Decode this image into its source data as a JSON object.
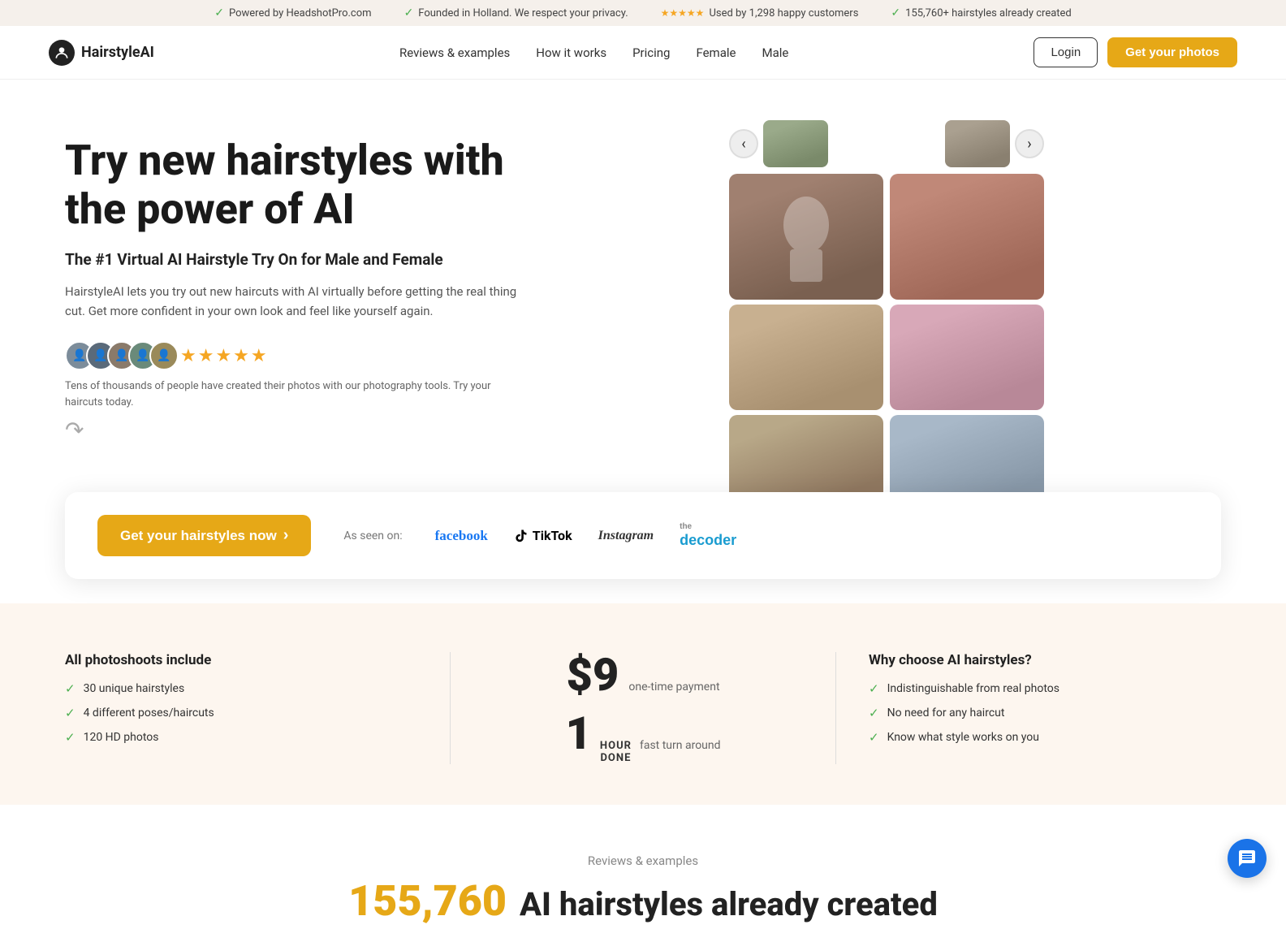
{
  "topBanner": {
    "items": [
      {
        "icon": "✓",
        "text": "Powered by HeadshotPro.com"
      },
      {
        "icon": "✓",
        "text": "Founded in Holland. We respect your privacy."
      },
      {
        "stars": "★★★★★",
        "text": "Used by 1,298 happy customers"
      },
      {
        "icon": "✓",
        "text": "155,760+ hairstyles already created"
      }
    ]
  },
  "navbar": {
    "logo": "HairstyleAI",
    "links": [
      {
        "label": "Reviews & examples",
        "href": "#"
      },
      {
        "label": "How it works",
        "href": "#"
      },
      {
        "label": "Pricing",
        "href": "#"
      },
      {
        "label": "Female",
        "href": "#"
      },
      {
        "label": "Male",
        "href": "#"
      }
    ],
    "loginLabel": "Login",
    "ctaLabel": "Get your photos"
  },
  "hero": {
    "title": "Try new hairstyles with the power of AI",
    "subtitle": "The #1 Virtual AI Hairstyle Try On for Male and Female",
    "description": "HairstyleAI lets you try out new haircuts with AI virtually before getting the real thing cut. Get more confident in your own look and feel like yourself again.",
    "stars": "★★★★★",
    "socialProof": "Tens of thousands of people have created their photos with our photography tools. Try your haircuts today."
  },
  "ctaStrip": {
    "buttonLabel": "Get your hairstyles now",
    "buttonArrow": "›",
    "asSeenLabel": "As seen on:",
    "logos": [
      {
        "name": "facebook",
        "label": "facebook"
      },
      {
        "name": "tiktok",
        "label": "TikTok"
      },
      {
        "name": "instagram",
        "label": "Instagram"
      },
      {
        "name": "decoder",
        "label": "the\ndecoder"
      }
    ]
  },
  "features": {
    "col1": {
      "title": "All photoshoots include",
      "items": [
        "30 unique hairstyles",
        "4 different poses/haircuts",
        "120 HD photos"
      ]
    },
    "col2": {
      "price": "$9",
      "priceLabel": "one-time payment",
      "hour": "1",
      "hourDone": "HOUR\nDONE",
      "hourLabel": "fast turn around"
    },
    "col3": {
      "title": "Why choose AI hairstyles?",
      "items": [
        "Indistinguishable from real photos",
        "No need for any haircut",
        "Know what style works on you"
      ]
    }
  },
  "reviewsSection": {
    "label": "Reviews & examples",
    "number": "155,760",
    "numberText": "AI hairstyles already created"
  },
  "chat": {
    "label": "Chat support"
  }
}
